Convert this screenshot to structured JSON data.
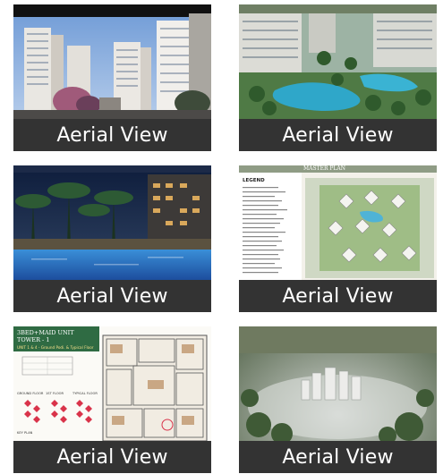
{
  "gallery": {
    "items": [
      {
        "caption": "Aerial View"
      },
      {
        "caption": "Aerial View"
      },
      {
        "caption": "Aerial View"
      },
      {
        "caption": "Aerial View"
      },
      {
        "caption": "Aerial View"
      },
      {
        "caption": "Aerial View"
      }
    ],
    "masterplan": {
      "heading": "MASTER PLAN",
      "legend_title": "LEGEND"
    },
    "floorplan": {
      "title_line1": "3BED+MAID UNIT",
      "title_line2": "TOWER - 1",
      "subtitle": "UNIT 1 & 4 - Ground Podi. & Typical Floor",
      "key_labels": [
        "GROUND FLOOR",
        "1ST FLOOR",
        "TYPICAL FLOOR"
      ],
      "key_plan": "KEY PLAN"
    }
  },
  "colors": {
    "caption_bg": "#333333",
    "caption_text": "#ffffff"
  }
}
